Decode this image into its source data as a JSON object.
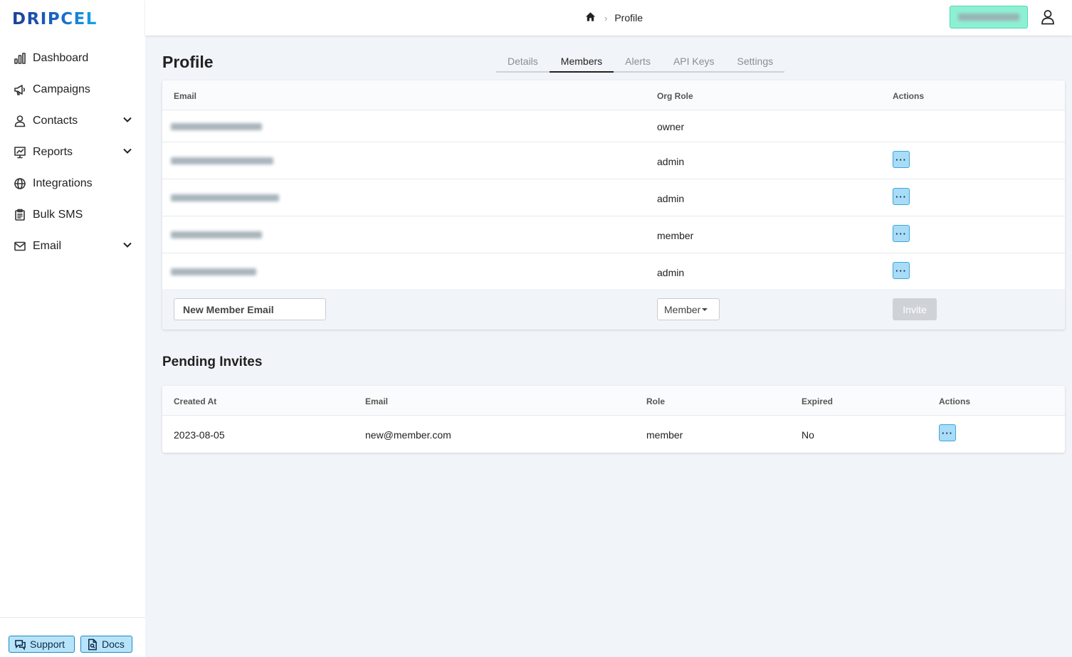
{
  "app": {
    "logo_text": "DRIPCEL"
  },
  "sidebar": {
    "items": [
      {
        "label": "Dashboard",
        "icon": "bar-chart-icon",
        "expandable": false
      },
      {
        "label": "Campaigns",
        "icon": "megaphone-icon",
        "expandable": false
      },
      {
        "label": "Contacts",
        "icon": "person-icon",
        "expandable": true
      },
      {
        "label": "Reports",
        "icon": "report-icon",
        "expandable": true
      },
      {
        "label": "Integrations",
        "icon": "globe-icon",
        "expandable": false
      },
      {
        "label": "Bulk SMS",
        "icon": "clipboard-icon",
        "expandable": false
      },
      {
        "label": "Email",
        "icon": "envelope-icon",
        "expandable": true
      }
    ],
    "footer": {
      "support_label": "Support",
      "docs_label": "Docs"
    }
  },
  "topbar": {
    "breadcrumb": {
      "current": "Profile"
    }
  },
  "page": {
    "title": "Profile",
    "tabs": [
      {
        "label": "Details",
        "active": false
      },
      {
        "label": "Members",
        "active": true
      },
      {
        "label": "Alerts",
        "active": false
      },
      {
        "label": "API Keys",
        "active": false
      },
      {
        "label": "Settings",
        "active": false
      }
    ]
  },
  "members": {
    "headers": {
      "email": "Email",
      "role": "Org Role",
      "actions": "Actions"
    },
    "rows": [
      {
        "role": "owner",
        "has_action": false
      },
      {
        "role": "admin",
        "has_action": true
      },
      {
        "role": "admin",
        "has_action": true
      },
      {
        "role": "member",
        "has_action": true
      },
      {
        "role": "admin",
        "has_action": true
      }
    ],
    "new_member": {
      "email_placeholder": "New Member Email",
      "role_value": "Member",
      "invite_label": "Invite"
    }
  },
  "pending_invites": {
    "title": "Pending Invites",
    "headers": {
      "created_at": "Created At",
      "email": "Email",
      "role": "Role",
      "expired": "Expired",
      "actions": "Actions"
    },
    "rows": [
      {
        "created_at": "2023-08-05",
        "email": "new@member.com",
        "role": "member",
        "expired": "No"
      }
    ]
  },
  "colors": {
    "accent_button": "#a8dcf7",
    "org_badge": "#8ef0d3",
    "background": "#f1f4f9"
  }
}
